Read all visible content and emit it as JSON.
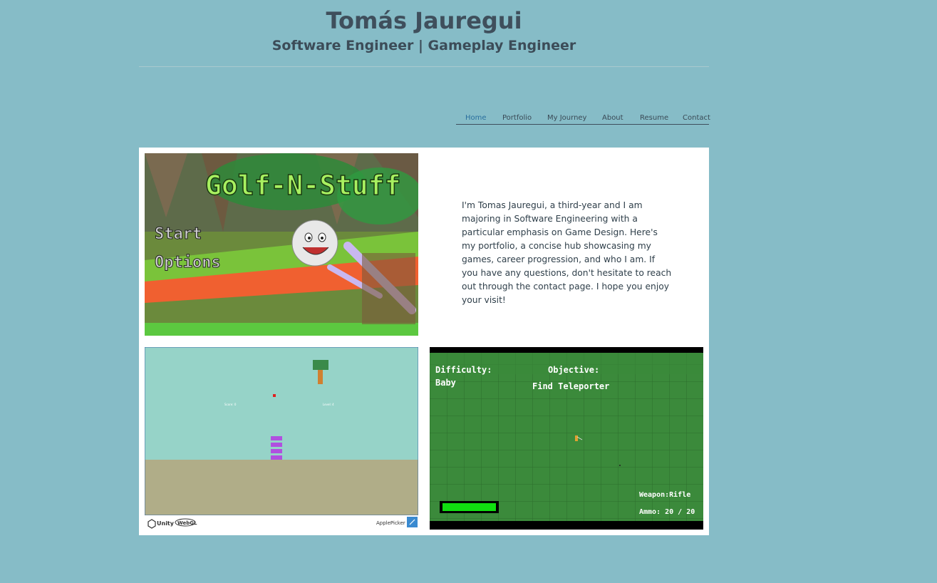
{
  "header": {
    "title": "Tomás Jauregui",
    "subtitle": "Software Engineer | Gameplay Engineer"
  },
  "nav": {
    "items": [
      {
        "label": "Home",
        "active": true
      },
      {
        "label": "Portfolio"
      },
      {
        "label": "My Journey"
      },
      {
        "label": "About"
      },
      {
        "label": "Resume"
      },
      {
        "label": "Contact"
      }
    ]
  },
  "intro": {
    "text": "I'm Tomas Jauregui, a third-year and I am majoring in Software Engineering with a particular emphasis on Game Design. Here's my portfolio, a concise hub showcasing my games, career progression, and who I am. If you have any questions, don't hesitate to reach out through the contact page. I hope you enjoy your visit!"
  },
  "golf_game": {
    "title": "Golf-N-Stuff",
    "menu": [
      "Start",
      "Options"
    ]
  },
  "apple_picker": {
    "score_label": "Score: 0",
    "level_label": "Level: 4",
    "footer_left_1": "Unity",
    "footer_left_2": "WebGL",
    "footer_right": "ApplePicker",
    "fullscreen_icon": "expand-icon"
  },
  "shooter_game": {
    "difficulty_label": "Difficulty:",
    "difficulty_value": "Baby",
    "objective_label": "Objective:",
    "objective_value": "Find Teleporter",
    "weapon": "Weapon:Rifle",
    "ammo": "Ammo: 20 / 20",
    "health_fraction": 1.0
  },
  "colors": {
    "background": "#86bcc7",
    "panel": "#ffffff",
    "text": "#3f4f5c",
    "accent": "#2a6f9e"
  }
}
